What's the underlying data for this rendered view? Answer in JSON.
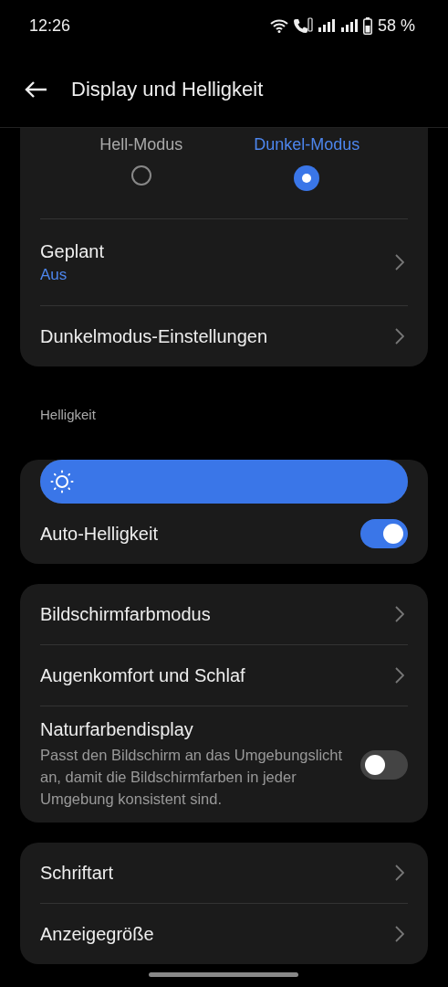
{
  "status_bar": {
    "time": "12:26",
    "battery": "58 %"
  },
  "header": {
    "title": "Display und Helligkeit"
  },
  "groups": [
    {
      "modes": [
        {
          "label": "Hell-Modus",
          "selected": false
        },
        {
          "label": "Dunkel-Modus",
          "selected": true
        }
      ],
      "rows": [
        {
          "kind": "link",
          "title": "Geplant",
          "value": "Aus"
        },
        {
          "kind": "link",
          "title": "Dunkelmodus-Einstellungen"
        }
      ]
    },
    {
      "label": "Helligkeit",
      "slider": {
        "level": 1
      },
      "rows": [
        {
          "kind": "toggle",
          "title": "Auto-Helligkeit",
          "on": true
        }
      ]
    },
    {
      "rows": [
        {
          "kind": "link",
          "title": "Bildschirmfarbmodus"
        },
        {
          "kind": "link",
          "title": "Augenkomfort und Schlaf"
        },
        {
          "kind": "toggle",
          "title": "Naturfarbendisplay",
          "description": "Passt den Bildschirm an das Umgebungslicht an, damit die Bildschirmfarben in jeder Umgebung konsistent sind.",
          "on": false
        }
      ]
    },
    {
      "rows": [
        {
          "kind": "link",
          "title": "Schriftart"
        },
        {
          "kind": "link",
          "title": "Anzeigegröße"
        }
      ]
    }
  ]
}
